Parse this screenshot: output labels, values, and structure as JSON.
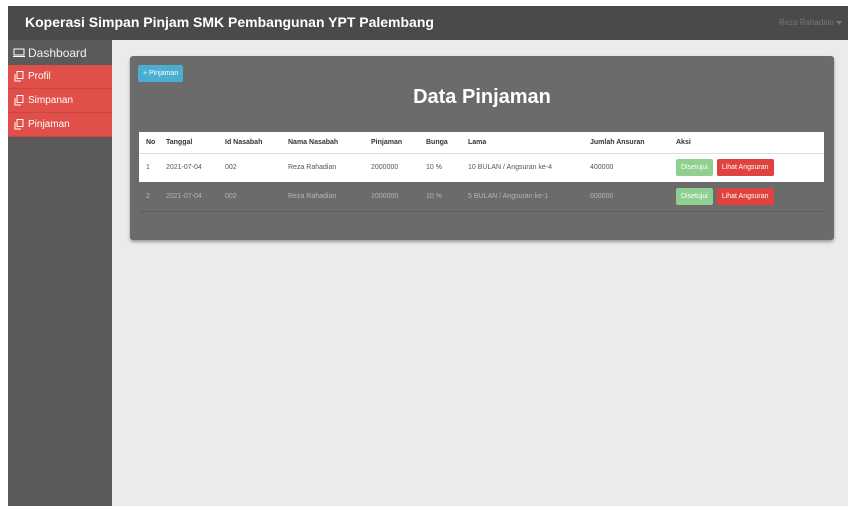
{
  "navbar": {
    "brand": "Koperasi Simpan Pinjam SMK Pembangunan YPT Palembang",
    "user": "Reza Rahadian"
  },
  "sidebar": {
    "items": [
      {
        "label": "Dashboard",
        "icon": "monitor-icon"
      },
      {
        "label": "Profil",
        "icon": "copy-icon"
      },
      {
        "label": "Simpanan",
        "icon": "copy-icon"
      },
      {
        "label": "Pinjaman",
        "icon": "copy-icon"
      }
    ]
  },
  "main": {
    "add_button": "+ Pinjaman",
    "title": "Data Pinjaman",
    "table": {
      "headers": [
        "No",
        "Tanggal",
        "Id Nasabah",
        "Nama Nasabah",
        "Pinjaman",
        "Bunga",
        "Lama",
        "Jumlah Ansuran",
        "Aksi"
      ],
      "rows": [
        {
          "no": "1",
          "tanggal": "2021-07-04",
          "id": "002",
          "nama": "Reza Rahadian",
          "pinjaman": "2000000",
          "bunga": "10 %",
          "lama": "10 BULAN / Angsuran ke-4",
          "jumlah": "400000",
          "status": "Disetujui",
          "action": "Lihat Angsuran"
        },
        {
          "no": "2",
          "tanggal": "2021-07-04",
          "id": "002",
          "nama": "Reza Rahadian",
          "pinjaman": "2000000",
          "bunga": "10 %",
          "lama": "5 BULAN / Angsuran ke-1",
          "jumlah": "600000",
          "status": "Disetujui",
          "action": "Lihat Angsuran"
        }
      ]
    }
  },
  "colors": {
    "navbar": "#4a4a4a",
    "sidebar": "#5a5a5a",
    "sidebar_active": "#e14f4b",
    "panel": "#6b6b6b",
    "add_button": "#4aaed0",
    "status_button": "#8fcf8f",
    "action_button": "#e0423e"
  }
}
